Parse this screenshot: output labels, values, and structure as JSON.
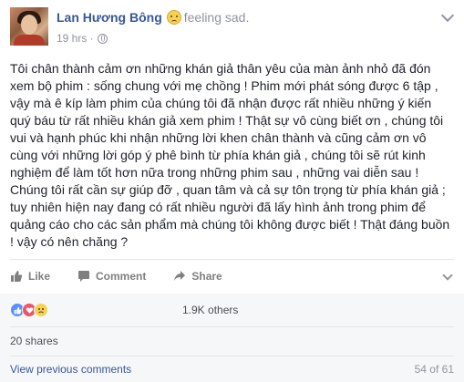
{
  "header": {
    "author_name": "Lan Hương Bông",
    "feeling_text": "feeling sad.",
    "timestamp": "19 hrs ·"
  },
  "post": {
    "text": "Tôi chân thành cảm ơn những khán giả thân yêu của màn ảnh nhỏ đã đón xem bộ phim : sống chung với mẹ chồng ! Phim mới phát sóng được 6 tập , vậy mà ê kíp làm phim của chúng tôi đã nhận được rất nhiều những ý kiến quý báu từ rất nhiều khán giả xem phim ! Thật sự vô cùng biết ơn , chúng tôi vui và hạnh phúc khi nhận những lời khen chân thành và cũng cảm ơn vô cùng với những lời góp ý phê bình từ phía khán giả , chúng tôi sẽ rút kinh nghiệm để làm tốt hơn nữa trong những phim sau , những vai diễn sau ! Chúng tôi rất cần sự giúp đỡ , quan tâm và cả sự tôn trọng từ phía khán giả ; tuy nhiên hiện nay đang có rất nhiều người đã lấy hình ảnh trong phim để quảng cáo cho các sản phẩm mà chúng tôi không được biết ! Thật đáng buồn ! vậy có nên chăng ?"
  },
  "actions": {
    "like": "Like",
    "comment": "Comment",
    "share": "Share"
  },
  "stats": {
    "reactions_count": "1.9K others",
    "shares": "20 shares",
    "view_previous": "View previous comments",
    "comment_count": "54 of 61"
  },
  "colors": {
    "link_blue": "#365899",
    "like_blue": "#5890ff",
    "love_red": "#f25268",
    "sad_yellow": "#f7d154"
  }
}
